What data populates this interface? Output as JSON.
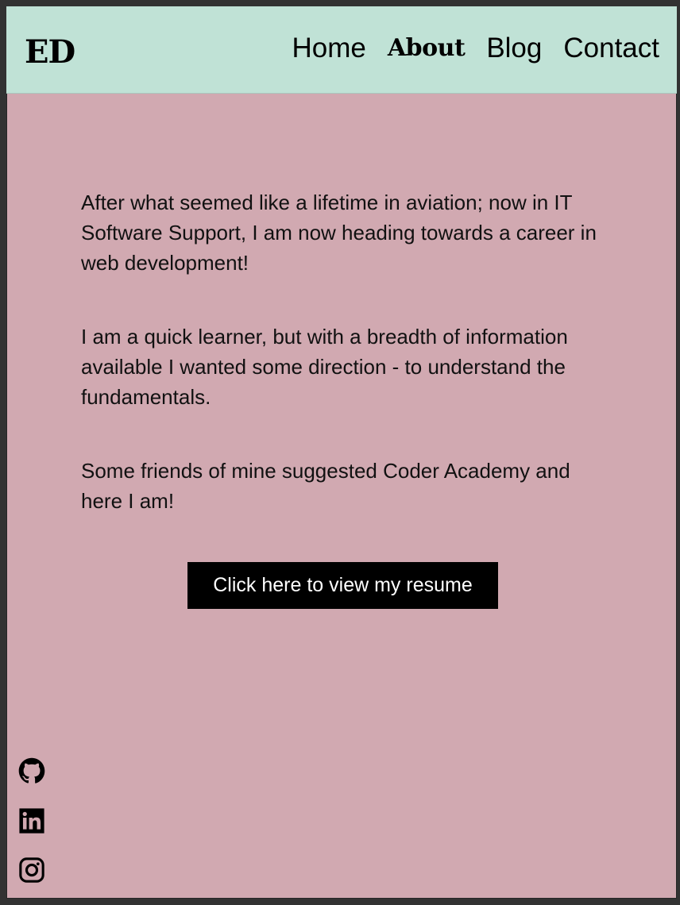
{
  "header": {
    "logo": "ED",
    "nav": [
      "Home",
      "About",
      "Blog",
      "Contact"
    ],
    "active": "About"
  },
  "main": {
    "paragraphs": [
      "After what seemed like a lifetime in aviation; now in IT Software Support, I am now heading towards a career in web development!",
      "I am a quick learner, but with a breadth of information available I wanted some direction - to understand the fundamentals.",
      "Some friends of mine suggested Coder Academy and here I am!"
    ],
    "resume_button": "Click here to view my resume"
  },
  "social": {
    "icons": [
      "github-icon",
      "linkedin-icon",
      "instagram-icon"
    ]
  },
  "colors": {
    "header_bg": "#c0e2d6",
    "page_bg": "#d1a9b1",
    "button_bg": "#000000",
    "text": "#000000"
  }
}
